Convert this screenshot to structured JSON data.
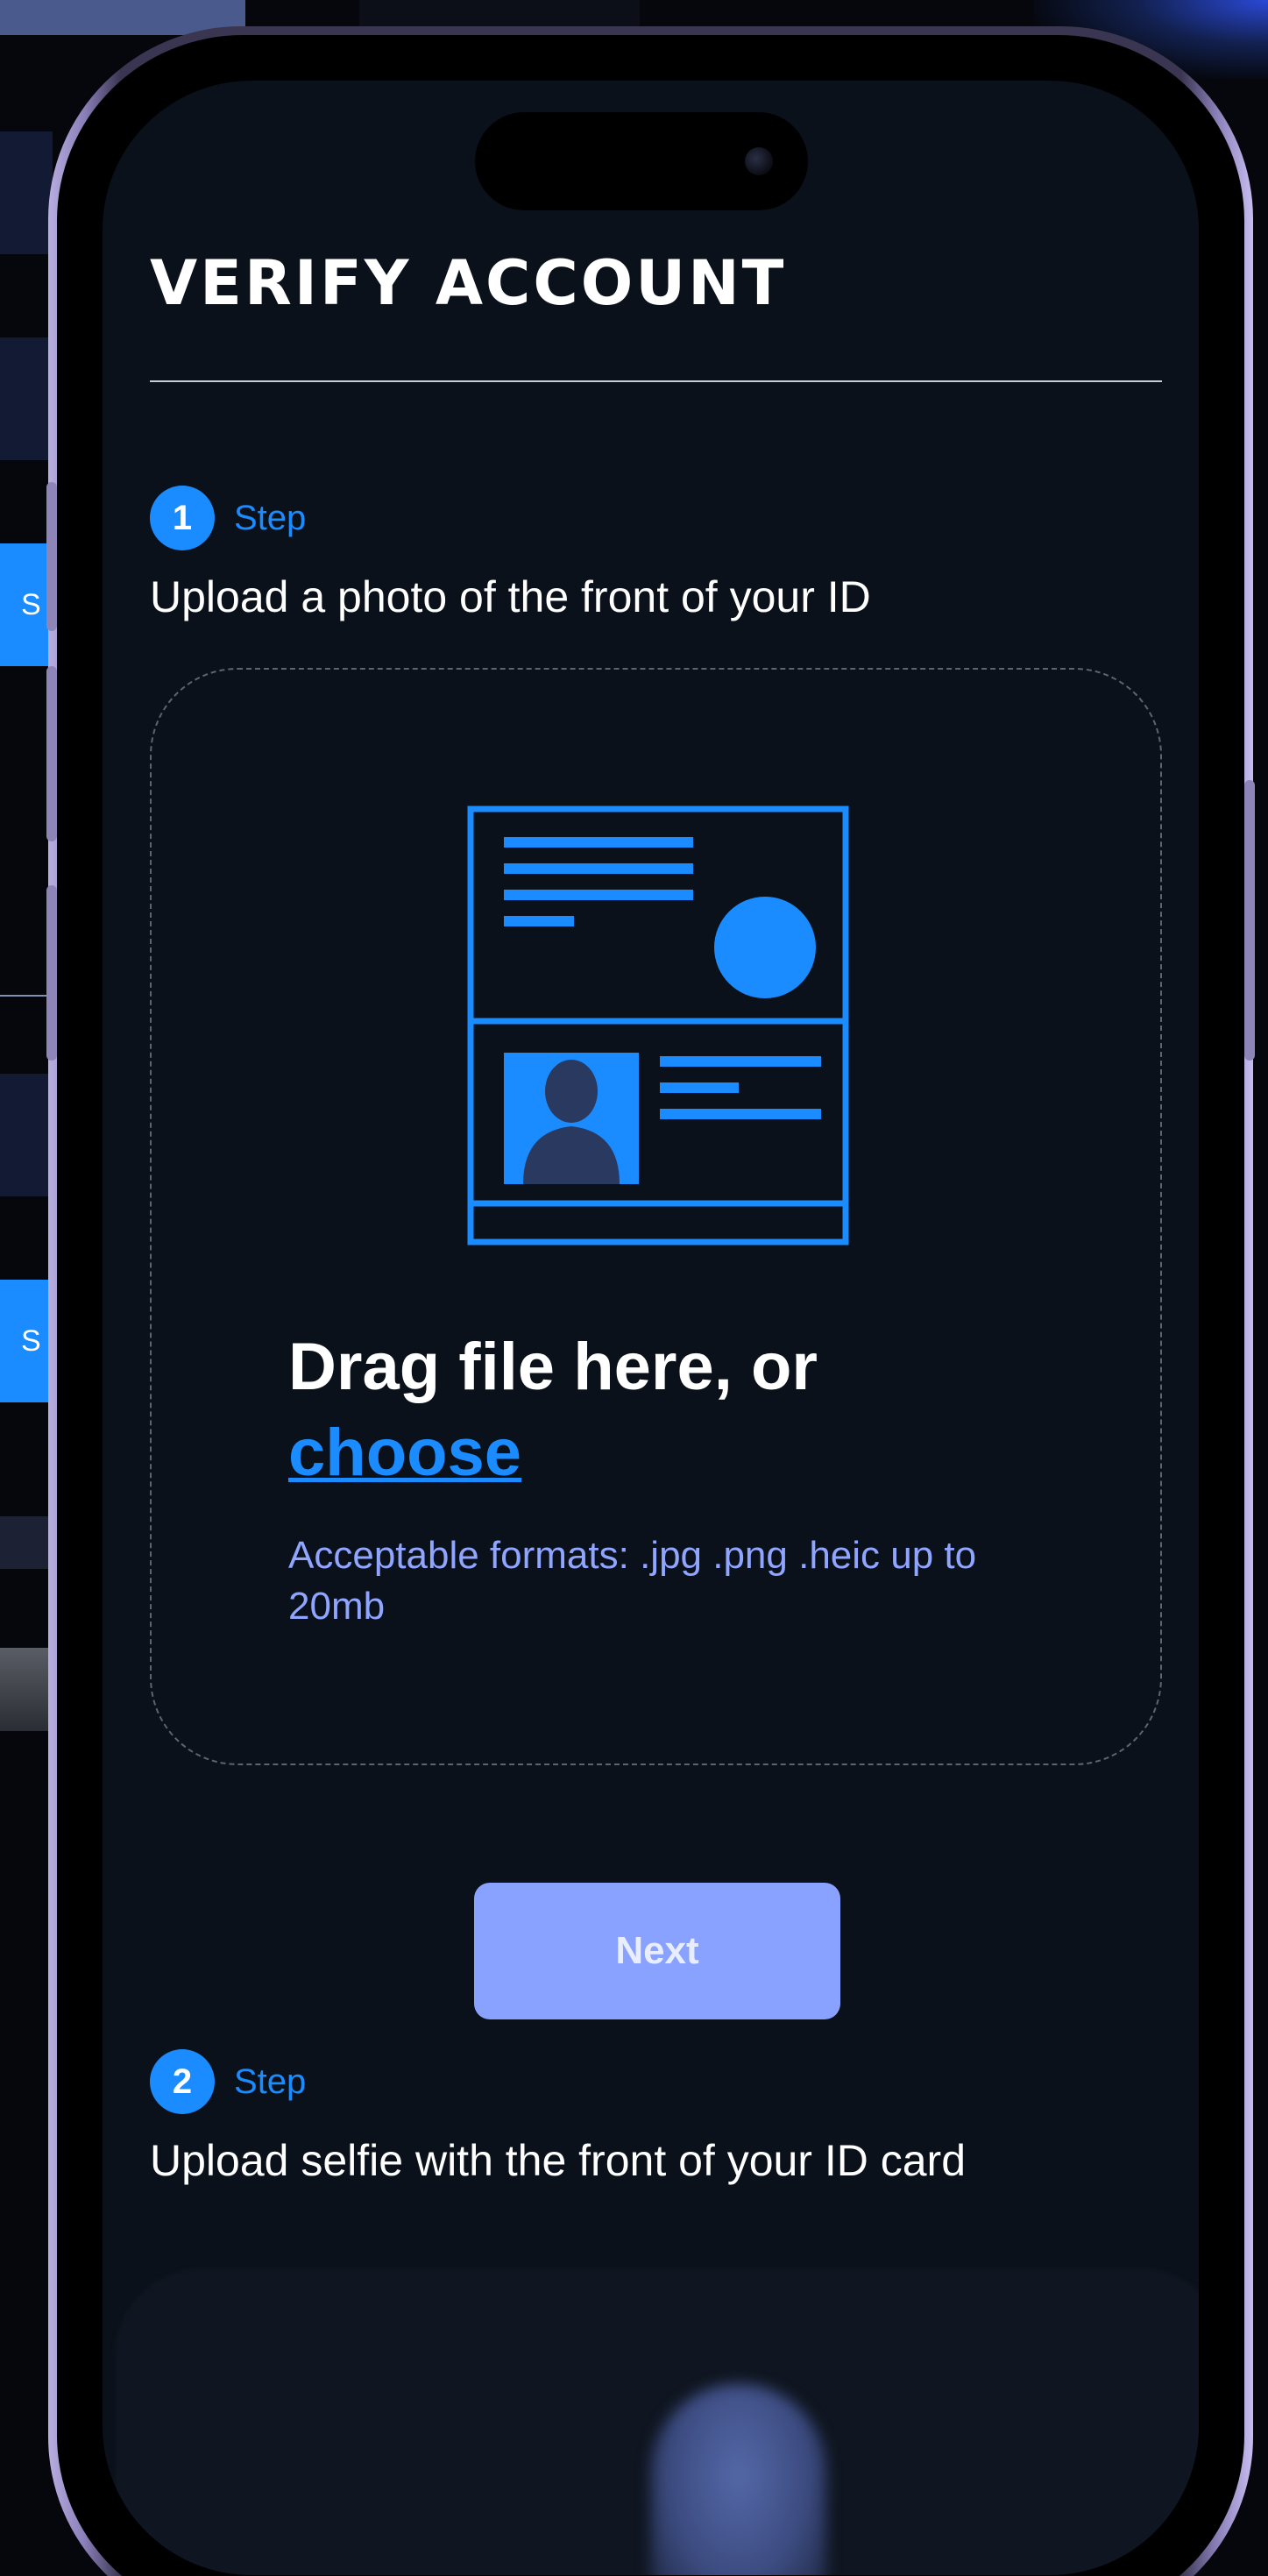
{
  "background": {
    "tab_letters": [
      "S",
      "S"
    ]
  },
  "verify": {
    "title": "VERIFY ACCOUNT"
  },
  "step1": {
    "number": "1",
    "label": "Step",
    "description": "Upload a photo of the front of your ID"
  },
  "dropzone": {
    "icon": "id-card-icon",
    "title": "Drag file here, or",
    "link": "choose",
    "hint": "Acceptable formats: .jpg .png .heic up to 20mb"
  },
  "next_button": {
    "label": "Next"
  },
  "step2": {
    "number": "2",
    "label": "Step",
    "description": "Upload selfie with the front of your ID card"
  },
  "colors": {
    "accent": "#1a8cff",
    "button": "#8aa2ff",
    "hint_text": "#8fa5ff",
    "screen_bg": "#0a111a"
  }
}
